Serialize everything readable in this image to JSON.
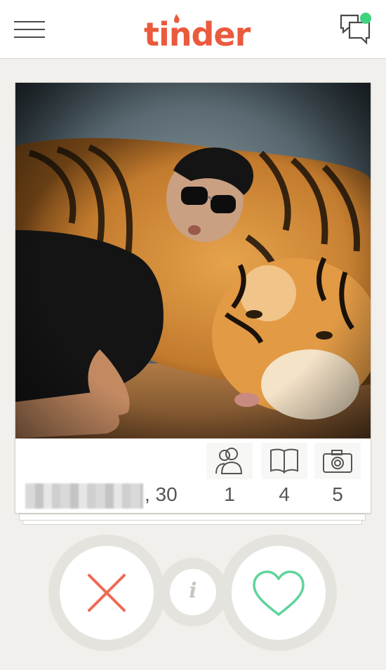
{
  "app": {
    "logo_text": "tinder",
    "brand_color": "#ea5a3c",
    "unread_dot_color": "#3fd37e"
  },
  "header": {
    "menu_icon": "hamburger-icon",
    "chat_icon": "chat-bubbles-icon"
  },
  "profile": {
    "name_redacted": true,
    "age_text": ", 30",
    "stats": [
      {
        "icon": "friends-icon",
        "value": "1"
      },
      {
        "icon": "book-icon",
        "value": "4"
      },
      {
        "icon": "camera-icon",
        "value": "5"
      }
    ]
  },
  "actions": {
    "nope_icon": "x-icon",
    "info_label": "i",
    "like_icon": "heart-icon",
    "nope_color": "#ef6a55",
    "like_color": "#5fd39a"
  }
}
